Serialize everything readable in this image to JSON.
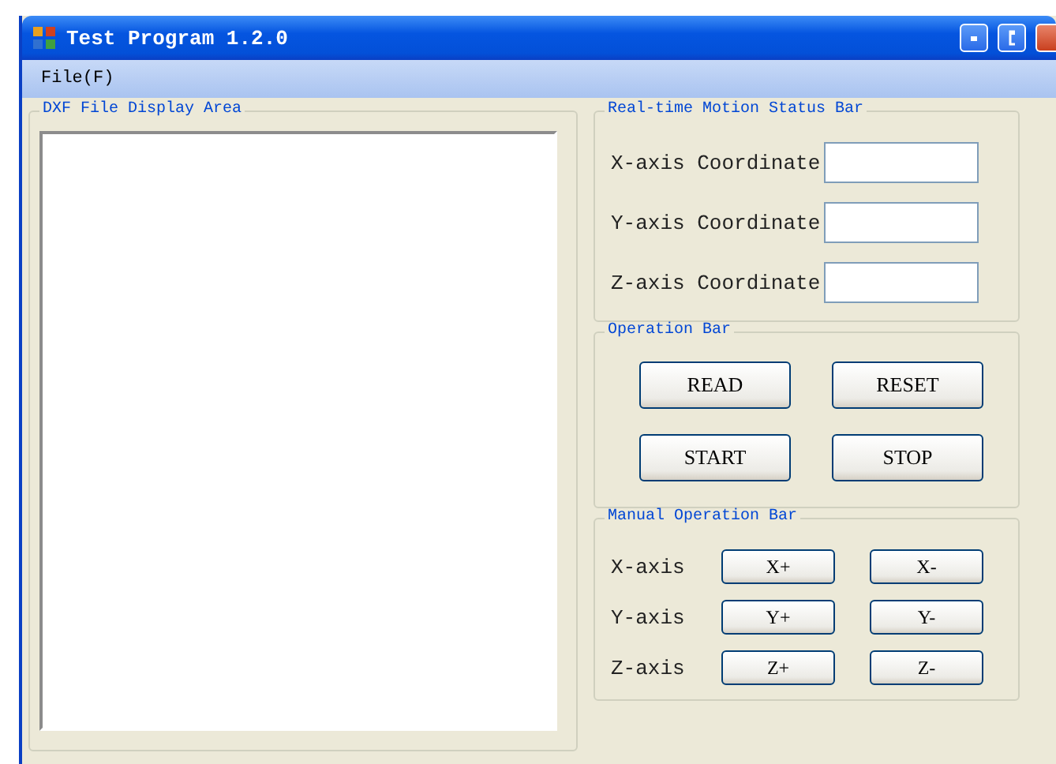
{
  "window": {
    "title": "Test Program 1.2.0"
  },
  "menu": [
    "File(F)"
  ],
  "display_area": {
    "title": "DXF File Display Area"
  },
  "status_bar": {
    "title": "Real-time Motion Status Bar",
    "fields": [
      {
        "label": "X-axis Coordinate"
      },
      {
        "label": "Y-axis Coordinate"
      },
      {
        "label": "Z-axis Coordinate"
      }
    ]
  },
  "operation_bar": {
    "title": "Operation Bar",
    "buttons": [
      "READ",
      "RESET",
      "START",
      "STOP"
    ]
  },
  "manual_bar": {
    "title": "Manual Operation Bar",
    "rows": [
      {
        "label": "X-axis",
        "buttons": [
          "X+",
          "X-"
        ]
      },
      {
        "label": "Y-axis",
        "buttons": [
          "Y+",
          "Y-"
        ]
      },
      {
        "label": "Z-axis",
        "buttons": [
          "Z+",
          "Z-"
        ]
      }
    ]
  }
}
